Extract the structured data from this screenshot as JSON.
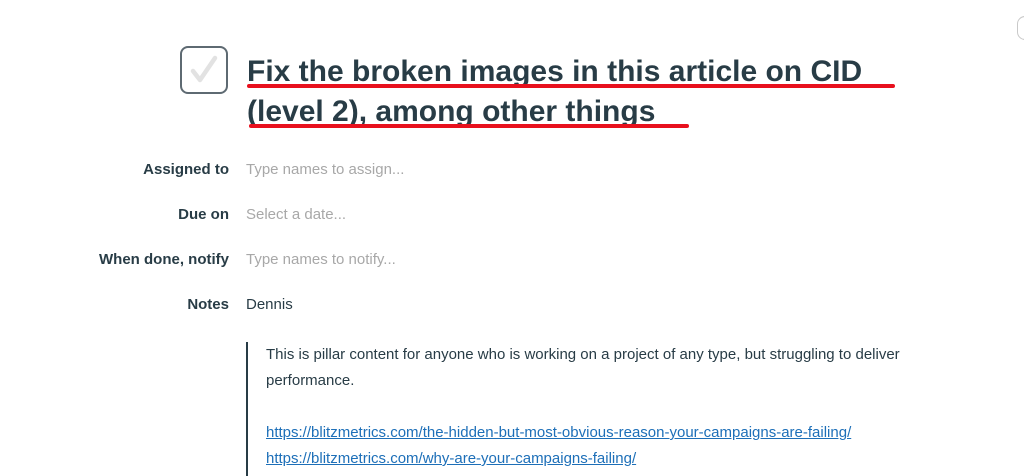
{
  "todo": {
    "title": "Fix the broken images in this article on CID (level 2), among other things",
    "completed": true
  },
  "fields": {
    "assigned_to": {
      "label": "Assigned to",
      "placeholder": "Type names to assign..."
    },
    "due_on": {
      "label": "Due on",
      "placeholder": "Select a date..."
    },
    "notify": {
      "label": "When done, notify",
      "placeholder": "Type names to notify..."
    },
    "notes": {
      "label": "Notes",
      "value": "Dennis"
    }
  },
  "notes_body": {
    "paragraph": "This is pillar content for anyone who is working on a project of any type, but struggling to deliver performance.",
    "links": [
      "https://blitzmetrics.com/the-hidden-but-most-obvious-reason-your-campaigns-are-failing/",
      "https://blitzmetrics.com/why-are-your-campaigns-failing/"
    ]
  },
  "colors": {
    "title_underline": "#e8101d",
    "link": "#1d6fb8",
    "text": "#283c46",
    "placeholder": "#a8a8a8"
  },
  "icons": {
    "checkbox": "checkmark-icon"
  }
}
